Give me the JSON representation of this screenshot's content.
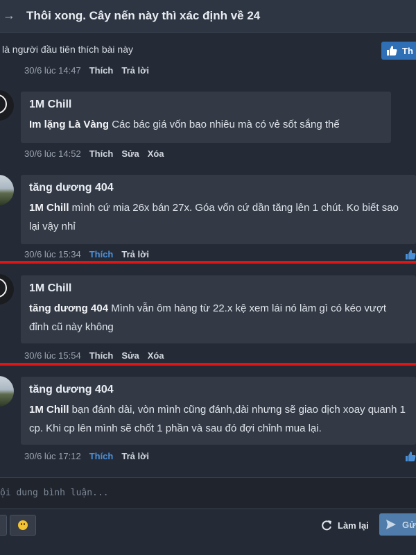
{
  "thread": {
    "title": "Thôi xong. Cây nến này thì xác định về 24",
    "likes_text": "là người đầu tiên thích bài này",
    "like_button": "Th"
  },
  "actions": {
    "like": "Thích",
    "reply": "Trả lời",
    "edit": "Sửa",
    "delete": "Xóa"
  },
  "comments": [
    {
      "time": "30/6 lúc 14:47"
    },
    {
      "author": "1M Chill",
      "mention": "Im lặng Là Vàng",
      "text": " Các bác giá vốn bao nhiêu mà có vẻ sốt sắng thế",
      "time": "30/6 lúc 14:52"
    },
    {
      "author": "tăng dương 404",
      "mention": "1M Chill",
      "text": " mình cứ mia 26x bán 27x. Góa vốn cứ dần tăng lên 1 chút. Ko biết sao lại vậy nhỉ",
      "time": "30/6 lúc 15:34"
    },
    {
      "author": "1M Chill",
      "mention": "tăng dương 404",
      "text": " Mình vẫn ôm hàng từ 22.x kệ xem lái nó làm gì có kéo vượt đỉnh cũ này không",
      "time": "30/6 lúc 15:54"
    },
    {
      "author": "tăng dương 404",
      "mention": "1M Chill",
      "text": " bạn đánh dài, vòn mình cũng đánh,dài nhưng sẽ giao dịch xoay quanh 1 cp. Khi cp lên mình sẽ chốt 1 phần và sau đó đợi chỉnh mua lại.",
      "time": "30/6 lúc 17:12"
    }
  ],
  "composer": {
    "placeholder": "ội dung bình luận...",
    "retry_label": "Làm lại",
    "send_label": "Gử"
  },
  "colors": {
    "accent": "#2f6fb5",
    "highlight_line": "#e01414",
    "liked": "#4a90d9"
  }
}
